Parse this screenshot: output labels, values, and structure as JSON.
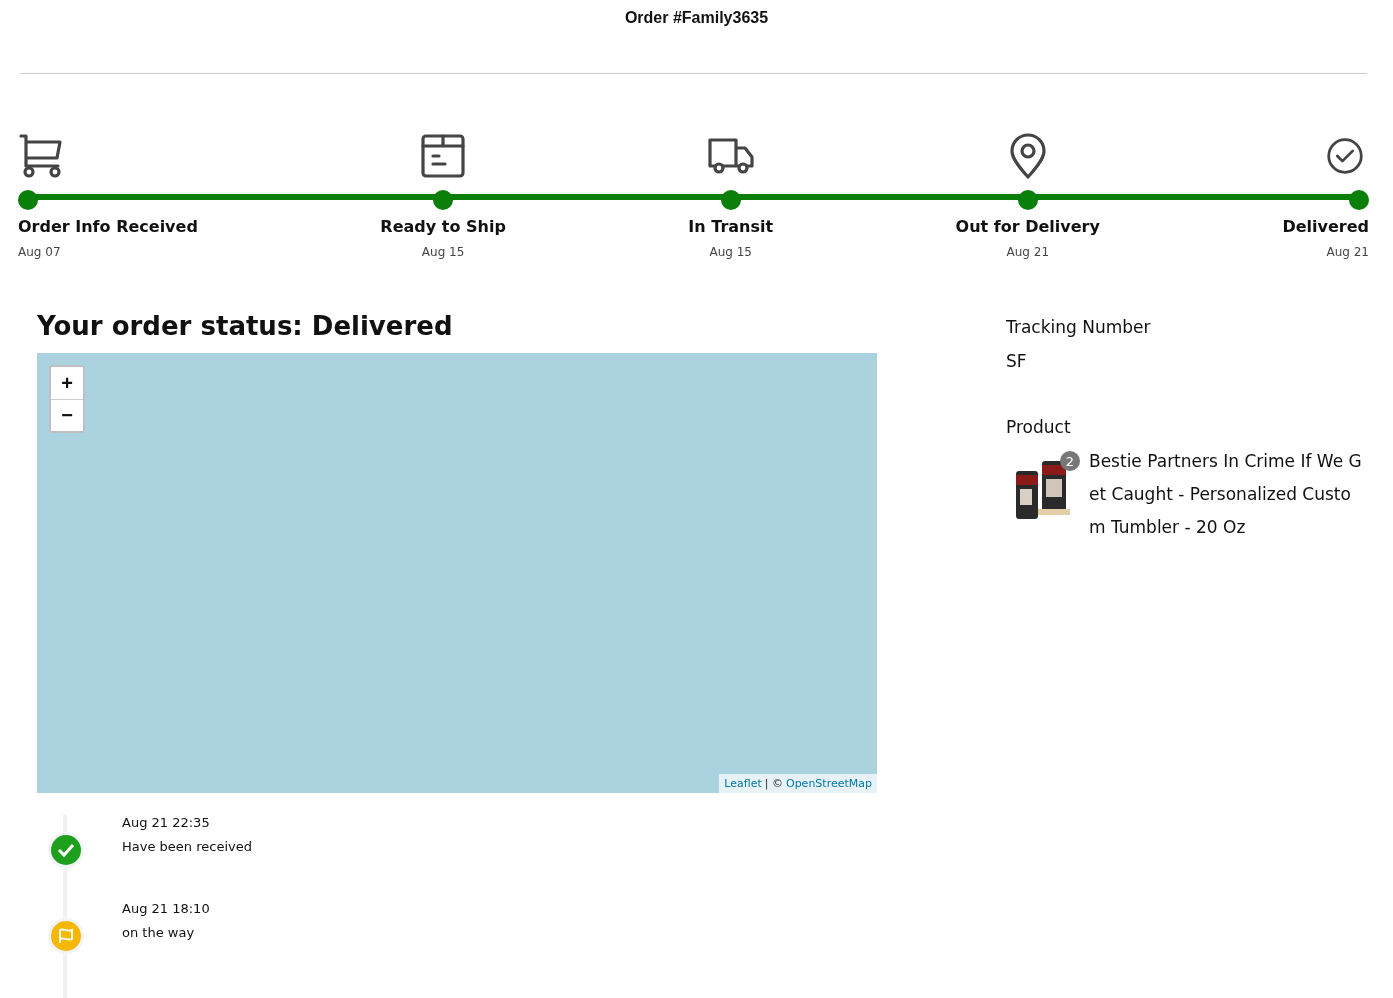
{
  "title": "Order  #Family3635",
  "steps": [
    {
      "kind": "cart",
      "label": "Order Info Received",
      "date": "Aug 07",
      "done": true
    },
    {
      "kind": "box",
      "label": "Ready to Ship",
      "date": "Aug 15",
      "done": true
    },
    {
      "kind": "truck",
      "label": "In Transit",
      "date": "Aug 15",
      "done": true
    },
    {
      "kind": "pin",
      "label": "Out for Delivery",
      "date": "Aug 21",
      "done": true
    },
    {
      "kind": "check",
      "label": "Delivered",
      "date": "Aug 21",
      "done": true
    }
  ],
  "status_heading": "Your order status: Delivered",
  "map": {
    "zoom_in": "+",
    "zoom_out": "−",
    "attribution_link": "Leaflet",
    "attribution_sep": "| ©",
    "attribution_osm": "OpenStreetMap"
  },
  "events": [
    {
      "kind": "received",
      "time": "Aug 21 22:35",
      "text": "Have been received"
    },
    {
      "kind": "transit",
      "time": "Aug 21 18:10",
      "text": "on the way"
    }
  ],
  "tracking": {
    "label": "Tracking Number",
    "value": "SF"
  },
  "product": {
    "label": "Product",
    "count": "2",
    "name": "Bestie Partners In Crime If We G et Caught - Personalized Custo m Tumbler - 20 Oz"
  }
}
